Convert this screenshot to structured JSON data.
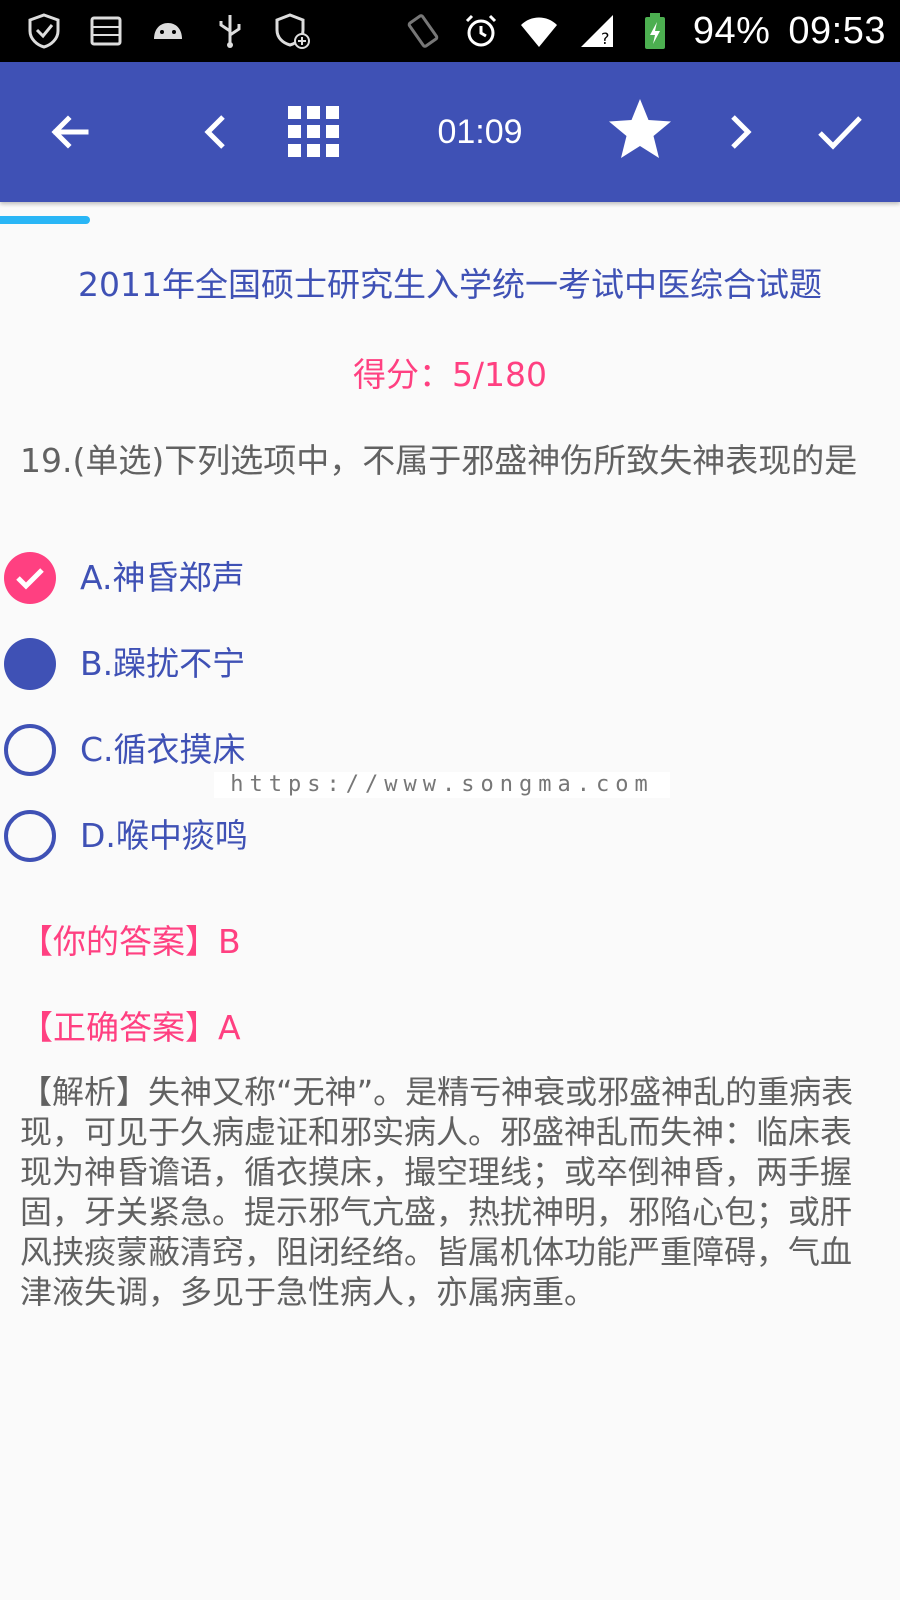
{
  "status_bar": {
    "icons_left": [
      "vpn-shield-icon",
      "storage-icon",
      "android-icon",
      "usb-icon",
      "shield-add-icon"
    ],
    "icons_right": [
      "rotate-icon",
      "alarm-icon",
      "wifi-icon",
      "signal-icon",
      "battery-icon"
    ],
    "battery": "94%",
    "time": "09:53"
  },
  "app_bar": {
    "timer": "01:09",
    "background": "#3f51b5"
  },
  "progress": {
    "fraction": 0.1
  },
  "exam": {
    "title": "2011年全国硕士研究生入学统一考试中医综合试题",
    "score": "得分：5/180"
  },
  "question": {
    "text": "19.(单选)下列选项中，不属于邪盛神伤所致失神表现的是"
  },
  "options": [
    {
      "label": "A.神昏郑声",
      "state": "correct"
    },
    {
      "label": "B.躁扰不宁",
      "state": "selected"
    },
    {
      "label": "C.循衣摸床",
      "state": "none"
    },
    {
      "label": "D.喉中痰鸣",
      "state": "none"
    }
  ],
  "watermark": "https://www.songma.com",
  "answers": {
    "yours": "【你的答案】B",
    "correct": "【正确答案】A"
  },
  "analysis": "【解析】失神又称“无神”。是精亏神衰或邪盛神乱的重病表现，可见于久病虚证和邪实病人。邪盛神乱而失神：临床表现为神昏谵语，循衣摸床，撮空理线；或卒倒神昏，两手握固，牙关紧急。提示邪气亢盛，热扰神明，邪陷心包；或肝风挟痰蒙蔽清窍，阻闭经络。皆属机体功能严重障碍，气血津液失调，多见于急性病人，亦属病重。",
  "colors": {
    "primary": "#3f51b5",
    "accent": "#ff4081",
    "text_secondary": "#616161"
  }
}
